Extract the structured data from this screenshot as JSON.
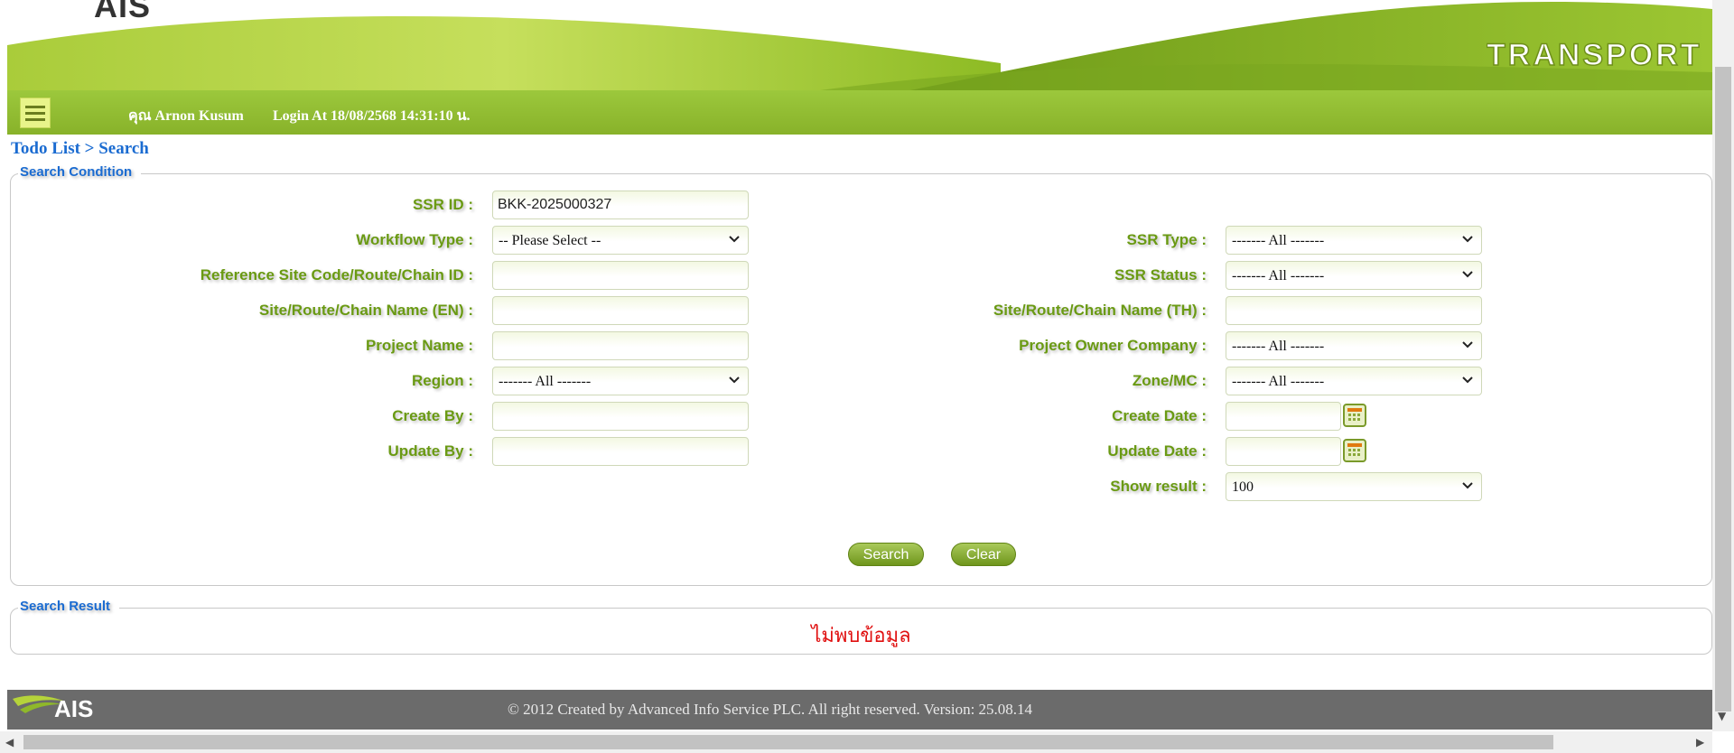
{
  "header": {
    "logo_text": "AIS",
    "app_title": "TRANSPORT"
  },
  "navbar": {
    "user": "คุณ Arnon Kusum",
    "login": "Login At 18/08/2568 14:31:10 น."
  },
  "breadcrumb": "Todo List > Search",
  "search_condition": {
    "legend": "Search Condition",
    "ssr_id_label": "SSR ID :",
    "ssr_id_value": "BKK-2025000327",
    "workflow_type_label": "Workflow Type :",
    "workflow_type_value": "-- Please Select --",
    "ref_site_label": "Reference Site Code/Route/Chain ID :",
    "site_name_en_label": "Site/Route/Chain Name (EN) :",
    "project_name_label": "Project Name :",
    "region_label": "Region :",
    "region_value": "------- All -------",
    "create_by_label": "Create By :",
    "update_by_label": "Update By :",
    "ssr_type_label": "SSR Type :",
    "ssr_type_value": "------- All -------",
    "ssr_status_label": "SSR Status :",
    "ssr_status_value": "------- All -------",
    "site_name_th_label": "Site/Route/Chain Name (TH) :",
    "project_owner_label": "Project Owner Company :",
    "project_owner_value": "------- All -------",
    "zone_label": "Zone/MC :",
    "zone_value": "------- All -------",
    "create_date_label": "Create Date :",
    "update_date_label": "Update Date :",
    "show_result_label": "Show result :",
    "show_result_value": "100",
    "search_button": "Search",
    "clear_button": "Clear"
  },
  "search_result": {
    "legend": "Search Result",
    "message": "ไม่พบข้อมูล"
  },
  "footer": {
    "logo_text": "AIS",
    "text": "© 2012 Created by Advanced Info Service PLC.  All right reserved.   Version: 25.08.14"
  },
  "colors": {
    "brand_green": "#88b22a",
    "label_green": "#6a9a13",
    "link_blue": "#1a6bd1",
    "error_red": "#e01010",
    "footer_gray": "#6b6b6b"
  }
}
